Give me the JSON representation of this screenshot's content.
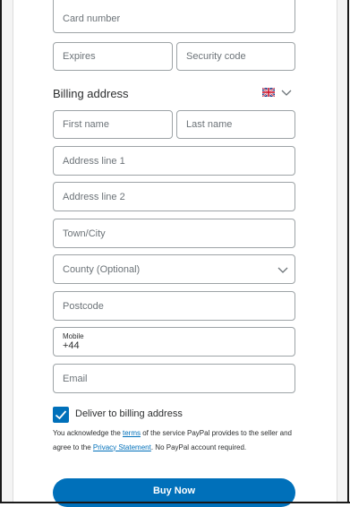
{
  "card": {
    "card_number_placeholder": "Card number",
    "expires_placeholder": "Expires",
    "security_code_placeholder": "Security code"
  },
  "billing": {
    "title": "Billing address",
    "country_flag": "uk-flag-icon",
    "first_name_placeholder": "First name",
    "last_name_placeholder": "Last name",
    "address_line_1_placeholder": "Address line 1",
    "address_line_2_placeholder": "Address line 2",
    "town_city_placeholder": "Town/City",
    "county_placeholder": "County (Optional)",
    "postcode_placeholder": "Postcode",
    "mobile_label": "Mobile",
    "mobile_value": "+44",
    "email_placeholder": "Email"
  },
  "deliver": {
    "checked": true,
    "label": "Deliver to billing address"
  },
  "legal": {
    "text_before_terms": "You acknowledge the ",
    "terms_link": "terms",
    "text_middle": " of the service PayPal provides to the seller and agree to the ",
    "privacy_link": "Privacy Statement",
    "text_after": ". No PayPal account required."
  },
  "actions": {
    "buy_now_label": "Buy Now"
  },
  "colors": {
    "accent": "#0070ba",
    "border": "#9da3a6",
    "placeholder": "#6c7378"
  }
}
